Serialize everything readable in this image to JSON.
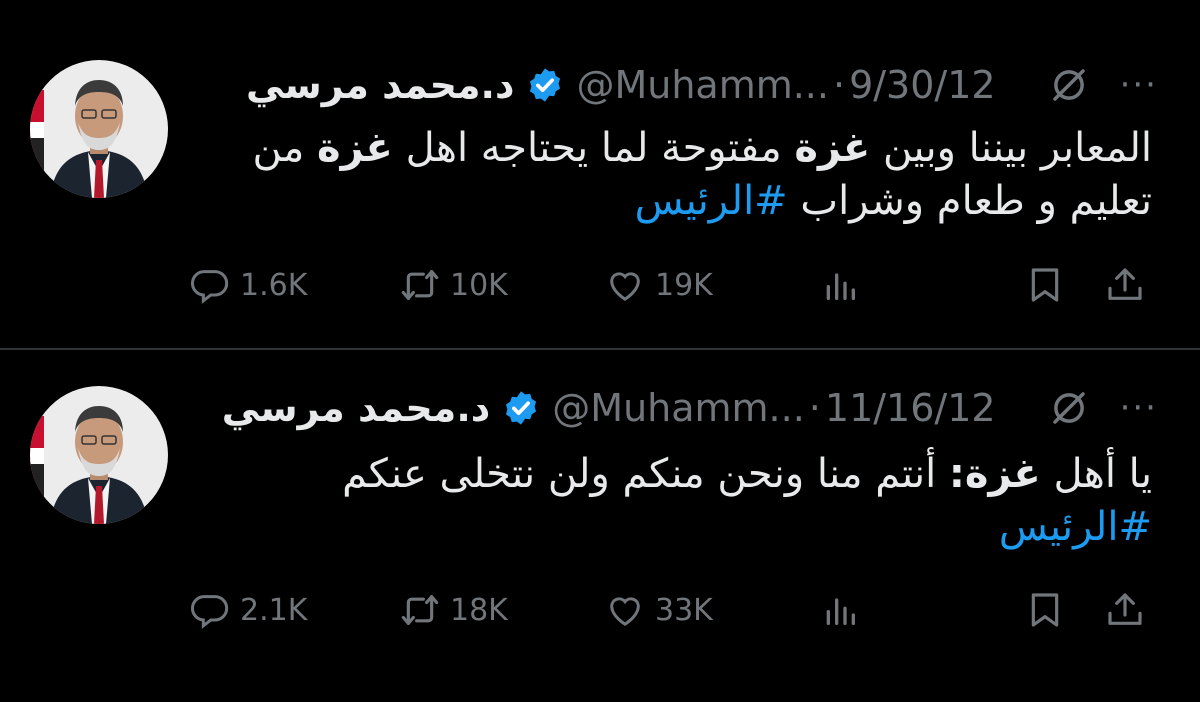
{
  "tweets": [
    {
      "author": {
        "name": "د.محمد مرسي",
        "handle": "@Muhamm...",
        "verified": true
      },
      "date": "9/30/12",
      "text": {
        "line1_a": "المعابر بيننا وبين ",
        "line1_b": "غزة",
        "line1_c": " مفتوحة لما يحتاجه اهل ",
        "line1_d": "غزة",
        "line1_e": " من",
        "line2": "تعليم و طعام وشراب ",
        "hashtag": "#الرئيس"
      },
      "stats": {
        "replies": "1.6K",
        "retweets": "10K",
        "likes": "19K"
      }
    },
    {
      "author": {
        "name": "د.محمد مرسي",
        "handle": "@Muhamm...",
        "verified": true
      },
      "date": "11/16/12",
      "text": {
        "line1_a": "يا أهل ",
        "line1_b": "غزة:",
        "line1_c": " أنتم منا ونحن منكم ولن نتخلى عنكم",
        "hashtag": "#الرئيس"
      },
      "stats": {
        "replies": "2.1K",
        "retweets": "18K",
        "likes": "33K"
      }
    }
  ],
  "colors": {
    "background": "#000000",
    "text": "#e7e9ea",
    "muted": "#71767b",
    "accent": "#1d9bf0"
  },
  "icons": [
    "verified-badge-icon",
    "grok-icon",
    "more-icon",
    "reply-icon",
    "retweet-icon",
    "like-icon",
    "views-icon",
    "bookmark-icon",
    "share-icon"
  ]
}
